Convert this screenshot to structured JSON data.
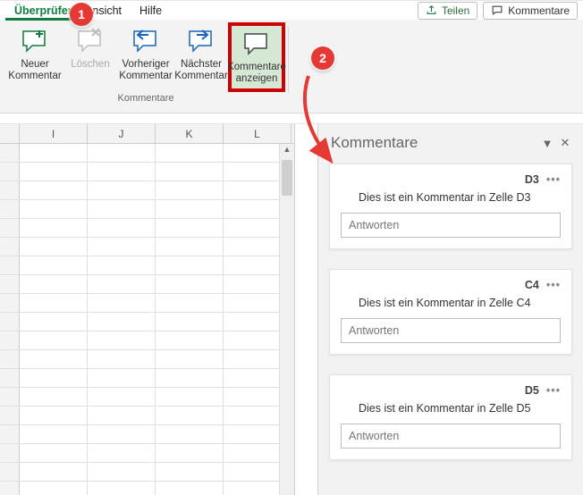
{
  "menu": {
    "active_tab": "Überprüfen",
    "tab2": "nsicht",
    "tab3": "Hilfe",
    "share_label": "Teilen",
    "comments_label": "Kommentare"
  },
  "ribbon": {
    "new_comment_l1": "Neuer",
    "new_comment_l2": "Kommentar",
    "delete": "Löschen",
    "prev_l1": "Vorheriger",
    "prev_l2": "Kommentar",
    "next_l1": "Nächster",
    "next_l2": "Kommentar",
    "show_l1": "Kommentare",
    "show_l2": "anzeigen",
    "group_label": "Kommentare"
  },
  "callouts": {
    "c1": "1",
    "c2": "2"
  },
  "sheet": {
    "cols": [
      "I",
      "J",
      "K",
      "L"
    ]
  },
  "pane": {
    "title": "Kommentare",
    "comments": [
      {
        "ref": "D3",
        "text": "Dies ist ein Kommentar in Zelle D3",
        "reply_placeholder": "Antworten"
      },
      {
        "ref": "C4",
        "text": "Dies ist ein Kommentar in Zelle C4",
        "reply_placeholder": "Antworten"
      },
      {
        "ref": "D5",
        "text": "Dies ist ein Kommentar in Zelle D5",
        "reply_placeholder": "Antworten"
      }
    ]
  }
}
